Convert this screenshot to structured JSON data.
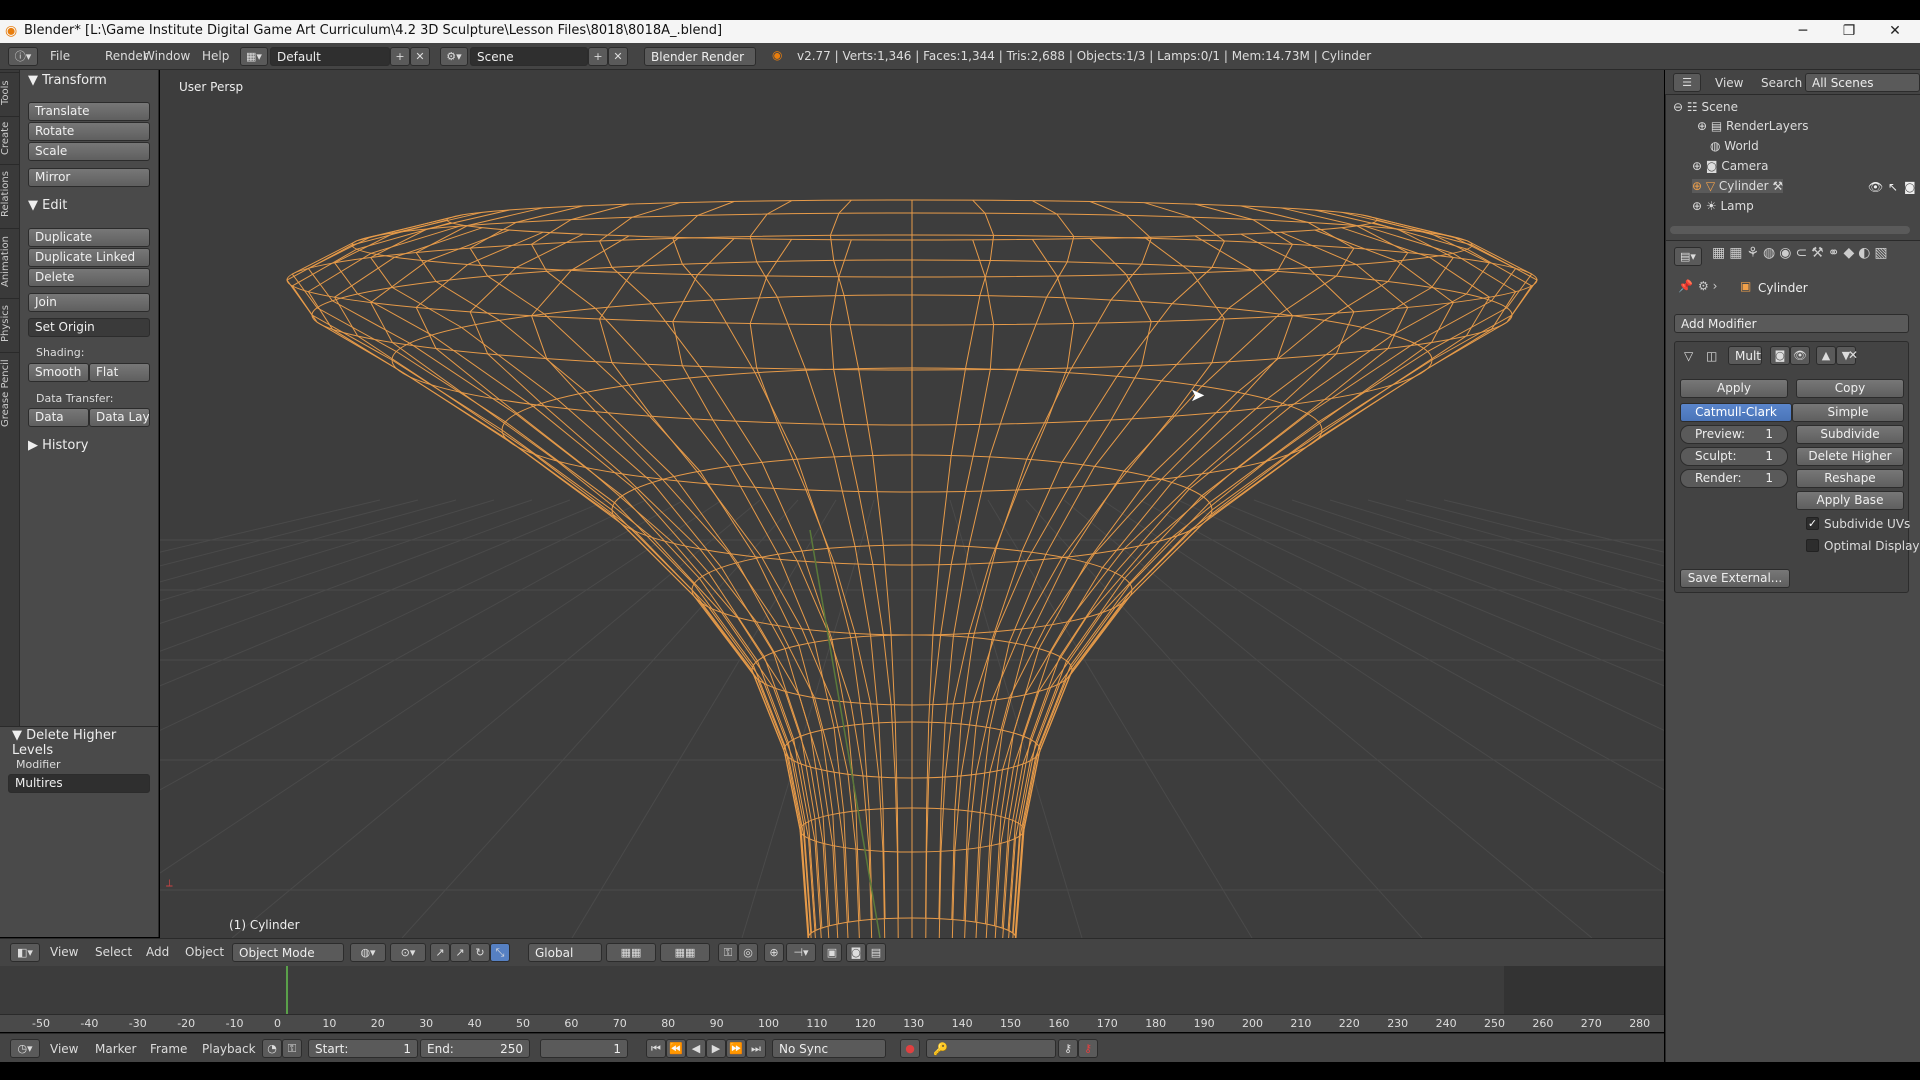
{
  "titlebar": {
    "title": "Blender* [L:\\Game Institute Digital Game Art  Curriculum\\4.2 3D Sculpture\\Lesson Files\\8018\\8018A_.blend]",
    "minimize": "─",
    "maximize": "❐",
    "close": "✕"
  },
  "topbar": {
    "menus": [
      "File",
      "Render",
      "Window",
      "Help"
    ],
    "layout": "Default",
    "scene": "Scene",
    "engine": "Blender Render",
    "stats": "v2.77 | Verts:1,346 | Faces:1,344 | Tris:2,688 | Objects:1/3 | Lamps:0/1 | Mem:14.73M | Cylinder"
  },
  "lefttabs": [
    "Tools",
    "Create",
    "Relations",
    "Animation",
    "Physics",
    "Grease Pencil"
  ],
  "toolshelf": {
    "transform_header": "Transform",
    "translate": "Translate",
    "rotate": "Rotate",
    "scale": "Scale",
    "mirror": "Mirror",
    "edit_header": "Edit",
    "duplicate": "Duplicate",
    "duplicate_linked": "Duplicate Linked",
    "delete": "Delete",
    "join": "Join",
    "set_origin": "Set Origin",
    "shading_label": "Shading:",
    "smooth": "Smooth",
    "flat": "Flat",
    "data_transfer_label": "Data Transfer:",
    "data": "Data",
    "data_layo": "Data Layo",
    "history_header": "History"
  },
  "redo": {
    "header": "Delete Higher Levels",
    "modifier_label": "Modifier",
    "modifier_value": "Multires"
  },
  "viewport": {
    "view_name": "User Persp",
    "object_label": "(1) Cylinder"
  },
  "vpfooter": {
    "menus": [
      "View",
      "Select",
      "Add",
      "Object"
    ],
    "mode": "Object Mode",
    "orientation": "Global"
  },
  "timeline": {
    "ticks": [
      "-50",
      "-40",
      "-30",
      "-20",
      "-10",
      "0",
      "10",
      "20",
      "30",
      "40",
      "50",
      "60",
      "70",
      "80",
      "90",
      "100",
      "110",
      "120",
      "130",
      "140",
      "150",
      "160",
      "170",
      "180",
      "190",
      "200",
      "210",
      "220",
      "230",
      "240",
      "250",
      "260",
      "270",
      "280"
    ],
    "menus": [
      "View",
      "Marker",
      "Frame",
      "Playback"
    ],
    "start_label": "Start:",
    "start": "1",
    "end_label": "End:",
    "end": "250",
    "current": "1",
    "sync": "No Sync"
  },
  "outliner": {
    "view": "View",
    "search": "Search",
    "filter": "All Scenes",
    "items": [
      "Scene",
      "RenderLayers",
      "World",
      "Camera",
      "Cylinder",
      "Lamp"
    ]
  },
  "properties": {
    "object_name": "Cylinder",
    "add_modifier": "Add Modifier",
    "modifier_name": "Multi",
    "apply": "Apply",
    "copy": "Copy",
    "catmull": "Catmull-Clark",
    "simple": "Simple",
    "preview_label": "Preview:",
    "preview": "1",
    "sculpt_label": "Sculpt:",
    "sculpt": "1",
    "render_label": "Render:",
    "render": "1",
    "subdivide": "Subdivide",
    "delete_higher": "Delete Higher",
    "reshape": "Reshape",
    "apply_base": "Apply Base",
    "subdivide_uvs": "Subdivide UVs",
    "optimal_display": "Optimal Display",
    "save_external": "Save External..."
  },
  "colors": {
    "wire": "#f0a04a",
    "grid": "#4a4a4a",
    "accent": "#5680c2"
  }
}
